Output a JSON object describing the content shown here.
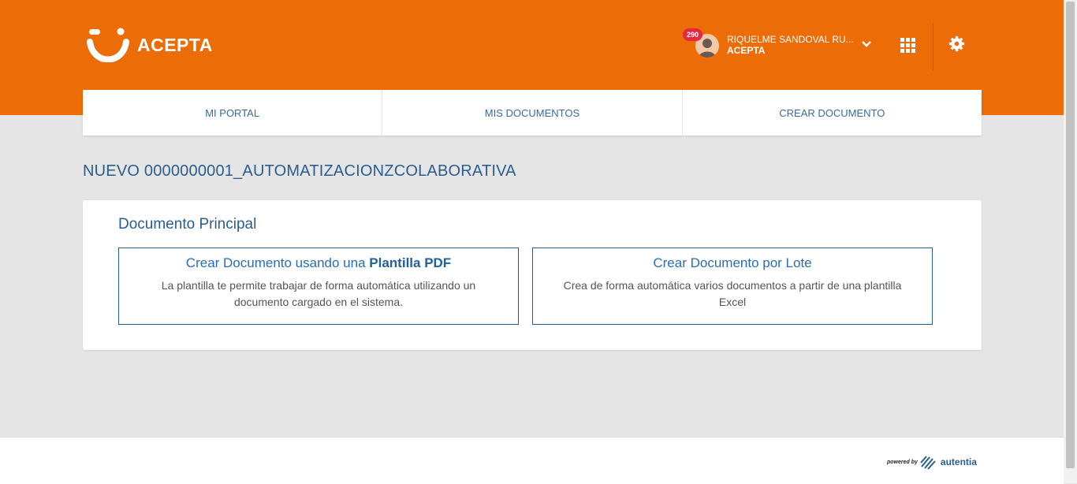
{
  "brand": {
    "name": "ACEPTA"
  },
  "user": {
    "notifications": "290",
    "name": "RIQUELME SANDOVAL RU...",
    "org": "ACEPTA"
  },
  "nav": {
    "tabs": [
      {
        "label": "MI PORTAL"
      },
      {
        "label": "MIS DOCUMENTOS"
      },
      {
        "label": "CREAR DOCUMENTO"
      }
    ]
  },
  "page": {
    "title": "NUEVO 0000000001_AUTOMATIZACIONZCOLABORATIVA"
  },
  "section": {
    "title": "Documento Principal",
    "options": [
      {
        "title_prefix": "Crear Documento usando una ",
        "title_bold": "Plantilla PDF",
        "description": "La plantilla te permite trabajar de forma automática utilizando un documento cargado en el sistema."
      },
      {
        "title_prefix": "Crear Documento por Lote",
        "title_bold": "",
        "description": "Crea de forma automática varios documentos a partir de una plantilla Excel"
      }
    ]
  },
  "footer": {
    "powered_by": "powered by",
    "provider": "autentia"
  },
  "colors": {
    "header": "#ec6c07",
    "accent": "#2a5d8f",
    "badge": "#e6283f"
  }
}
